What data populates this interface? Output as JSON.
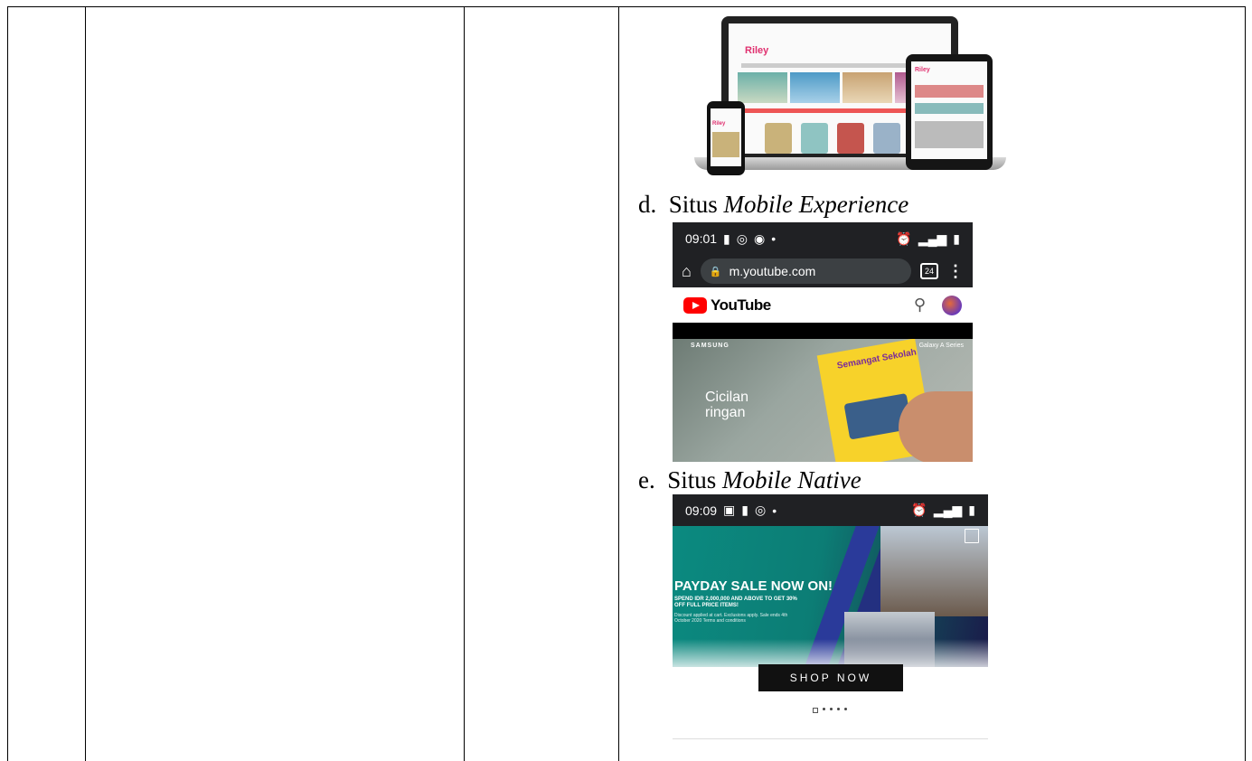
{
  "captions": {
    "d": {
      "marker": "d.",
      "prefix": "Situs",
      "italic": "Mobile Experience"
    },
    "e": {
      "marker": "e.",
      "prefix": "Situs",
      "italic": "Mobile Native"
    }
  },
  "device_mockup": {
    "site_logo": "Riley"
  },
  "youtube_screenshot": {
    "time": "09:01",
    "url": "m.youtube.com",
    "tab_count": "24",
    "logo_text": "YouTube",
    "ad": {
      "brand": "SAMSUNG",
      "series": "Galaxy A Series",
      "flyer_title": "Semangat Sekolah",
      "promo_line1": "Cicilan",
      "promo_line2": "ringan"
    }
  },
  "native_screenshot": {
    "time": "09:09",
    "headline": "PAYDAY SALE NOW ON!",
    "subhead": "SPEND IDR 2,000,000 AND ABOVE TO GET 30% OFF FULL PRICE ITEMS!",
    "disclaimer": "Discount applied at cart. Exclusions apply. Sale ends 4th October 2020 Terms and conditions",
    "cta": "SHOP NOW"
  }
}
